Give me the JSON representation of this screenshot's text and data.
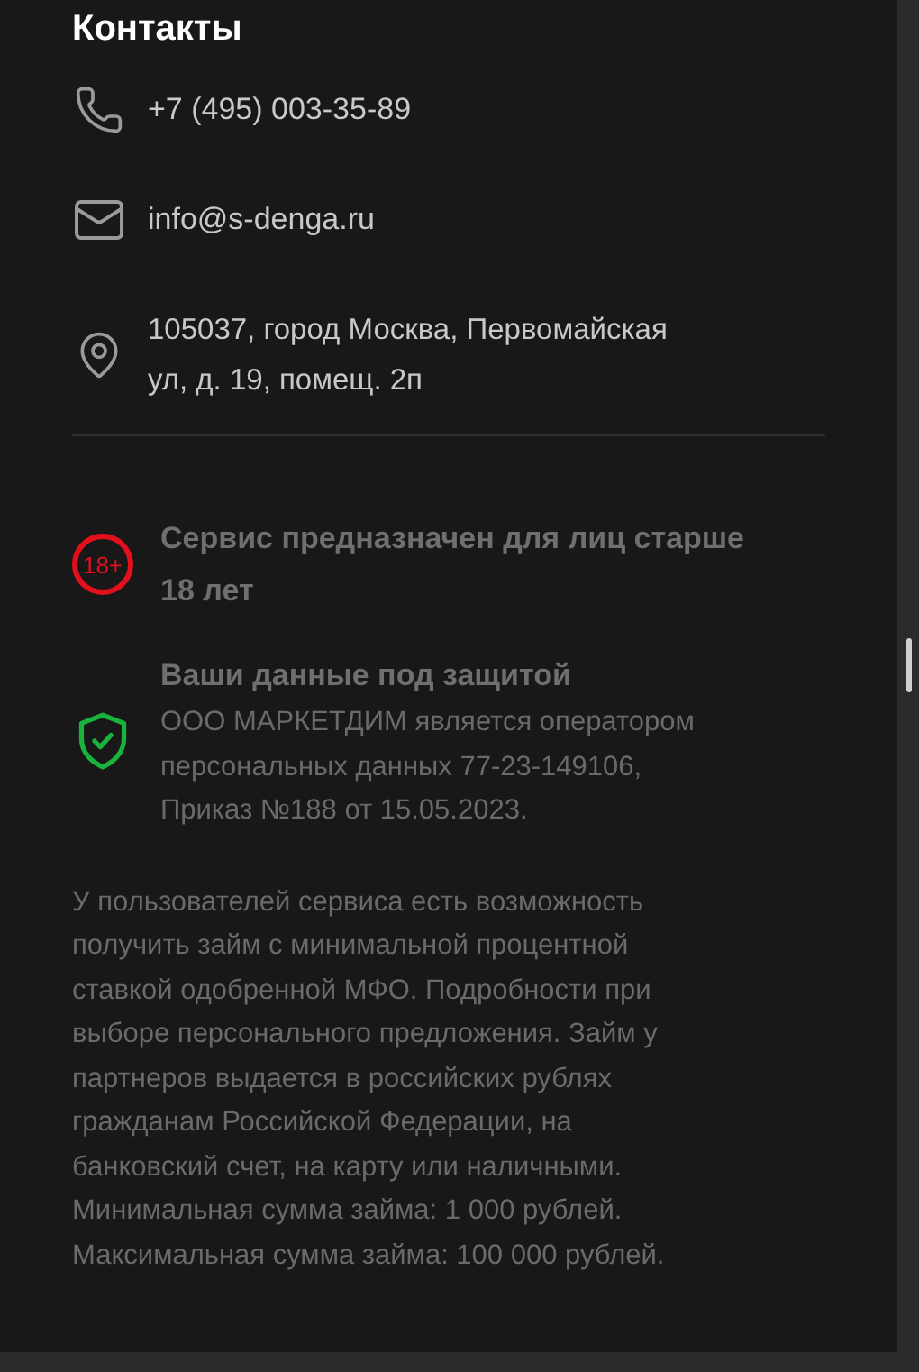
{
  "contacts": {
    "title": "Контакты",
    "items": [
      {
        "kind": "phone",
        "text": "+7 (495) 003-35-89"
      },
      {
        "kind": "email",
        "text": "info@s-denga.ru"
      },
      {
        "kind": "address",
        "text": "105037, город Москва, Первомайская ул, д. 19, помещ. 2п"
      }
    ]
  },
  "notices": [
    {
      "kind": "age",
      "badge": "18+",
      "title": "Сервис предназначен для лиц старше 18 лет"
    },
    {
      "kind": "security",
      "title": "Ваши данные под защитой",
      "text": "ООО МАРКЕТДИМ является оператором персональных данных 77-23-149106, Приказ №188 от 15.05.2023."
    }
  ],
  "disclaimer": "У пользователей сервиса есть возможность получить займ с минимальной процентной ставкой одобренной МФО. Подробности при выборе персонального предложения. Займ у партнеров выдается в российских рублях гражданам Российской Федерации, на банковский счет, на карту или наличными. Минимальная сумма займа: 1 000 рублей. Максимальная сумма займа: 100 000 рублей."
}
